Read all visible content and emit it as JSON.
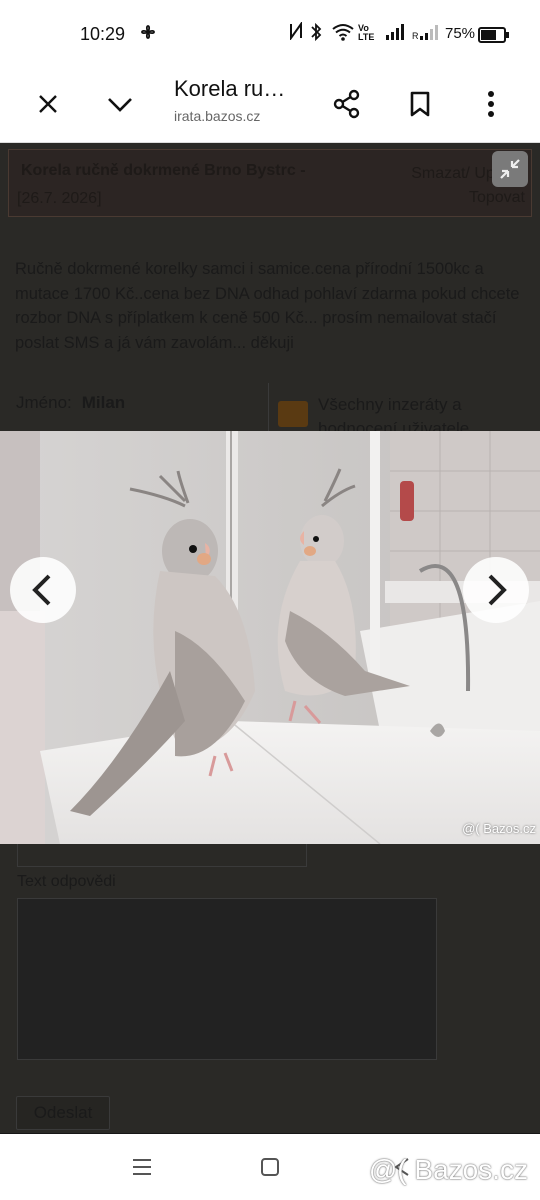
{
  "status_bar": {
    "time": "10:29",
    "battery": "75%",
    "battery_level": 0.75,
    "icons": [
      "fan-icon",
      "nfc-icon",
      "bluetooth-icon",
      "wifi-icon",
      "volte-icon",
      "signal-icon",
      "signal-r-icon",
      "battery-icon"
    ]
  },
  "browser": {
    "title": "Korela ru…",
    "url": "irata.bazos.cz",
    "icons": [
      "close-icon",
      "chevron-down-icon",
      "share-icon",
      "bookmark-icon",
      "more-vert-icon"
    ]
  },
  "listing": {
    "title": "Korela ručně dokrmené Brno Bystrc -",
    "date": "[26.7. 2026]",
    "action_delete": "Smazat/ Upravit",
    "action_top": "Topovat",
    "description": "Ručně dokrmené korelky samci i samice.cena přírodní 1500kc a mutace 1700 Kč..cena bez DNA odhad pohlaví zdarma pokud chcete rozbor DNA s příplatkem k ceně 500 Kč... prosím nemailovat stačí poslat SMS a já vám zavolám... děkuji",
    "name_label": "Jméno:",
    "name_value": "Milan",
    "user_link": "Všechny inzeráty a hodnocení uživatele"
  },
  "gallery": {
    "watermark": "@( Bazos.cz",
    "icons": [
      "chevron-left-icon",
      "chevron-right-icon",
      "collapse-icon"
    ]
  },
  "reply_form": {
    "text_label": "Text odpovědi",
    "submit_label": "Odeslat"
  },
  "nav_bar": {
    "watermark": "@( Bazos.cz",
    "icons": [
      "recents-icon",
      "home-icon",
      "back-icon"
    ]
  }
}
